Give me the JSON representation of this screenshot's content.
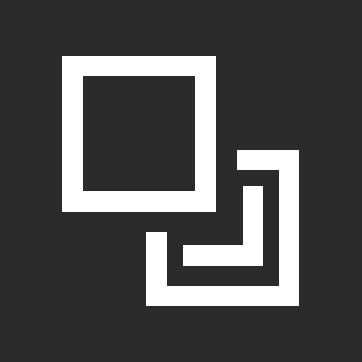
{
  "icon": {
    "name": "arrange-send-backward-icon",
    "background_color": "#2b2b2b",
    "foreground_color": "#ffffff"
  }
}
